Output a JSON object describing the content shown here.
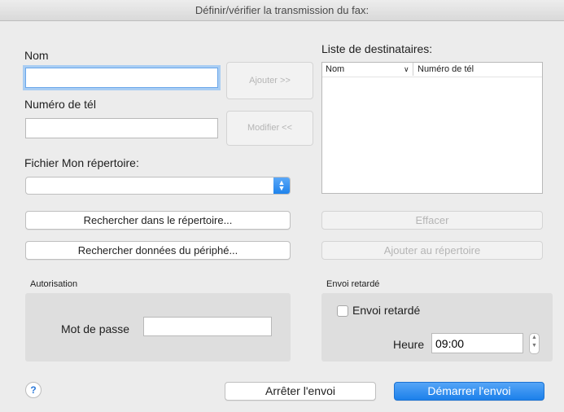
{
  "window": {
    "title": "Définir/vérifier la transmission du fax:"
  },
  "form": {
    "name_label": "Nom",
    "name_value": "",
    "phone_label": "Numéro de tél",
    "phone_value": "",
    "add_button": "Ajouter >>",
    "modify_button": "Modifier <<",
    "address_book_file_label": "Fichier Mon répertoire:",
    "address_book_file_value": "",
    "search_address_book_button": "Rechercher dans le répertoire...",
    "search_device_button": "Rechercher données du périphé..."
  },
  "recipients": {
    "label": "Liste de destinataires:",
    "columns": [
      "Nom",
      "Numéro de tél"
    ],
    "rows": [],
    "delete_button": "Effacer",
    "add_to_book_button": "Ajouter au répertoire"
  },
  "authorization": {
    "label": "Autorisation",
    "password_label": "Mot de passe",
    "password_value": ""
  },
  "delayed": {
    "label": "Envoi retardé",
    "checkbox_label": "Envoi retardé",
    "checked": false,
    "time_label": "Heure",
    "time_value": "09:00"
  },
  "footer": {
    "help": "?",
    "stop_button": "Arrêter l'envoi",
    "start_button": "Démarrer l'envoi"
  },
  "colors": {
    "accent": "#1c80ea",
    "focus_ring": "#a9cdf3",
    "group_bg": "#dedede"
  }
}
